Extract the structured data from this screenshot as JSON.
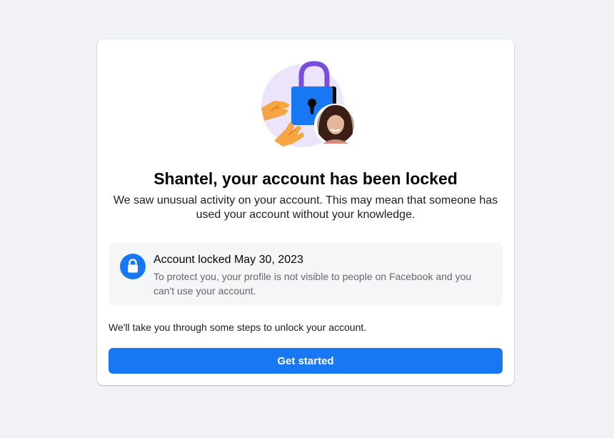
{
  "lock_screen": {
    "title": "Shantel, your account has been locked",
    "subtitle": "We saw unusual activity on your account. This may mean that someone has used your account without your knowledge.",
    "notice": {
      "icon": "lock-icon",
      "title": "Account locked May 30, 2023",
      "body": "To protect you, your profile is not visible to people on Facebook and you can't use your account."
    },
    "steps_text": "We'll take you through some steps to unlock your account.",
    "cta_label": "Get started"
  },
  "colors": {
    "page_background": "#f0f2f5",
    "accent": "#1877f2",
    "illustration_circle": "#ebe4fb",
    "padlock_shackle": "#7b4ddb",
    "hands": "#f7a543"
  }
}
